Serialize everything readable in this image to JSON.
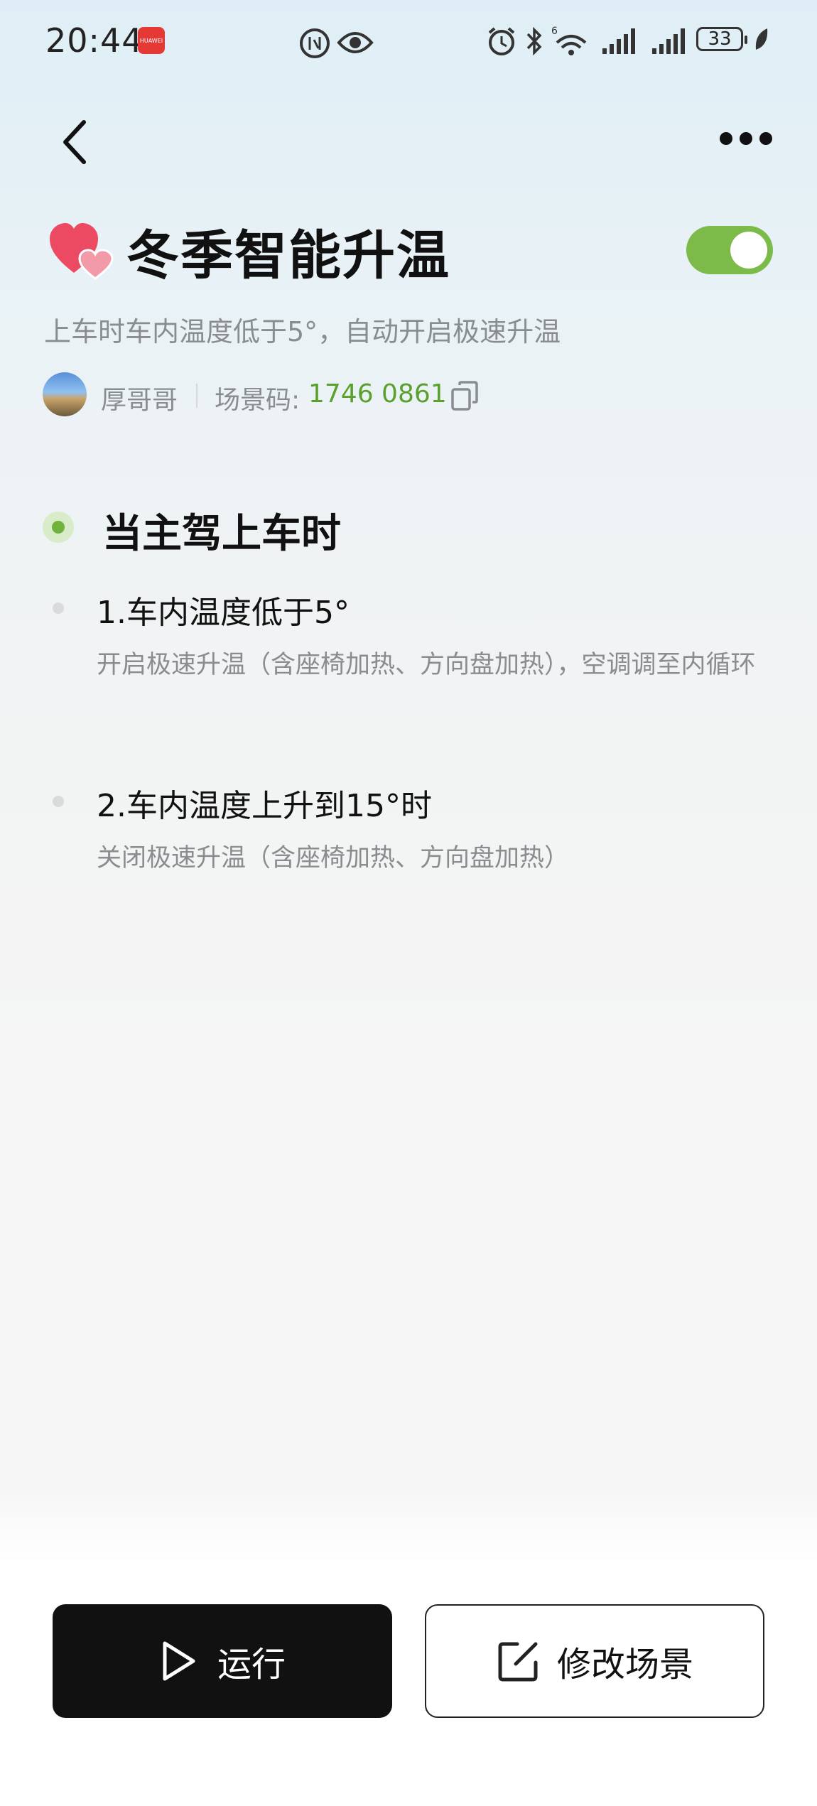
{
  "status_bar": {
    "time": "20:44",
    "app_badge": "HUAWEI",
    "battery": "33"
  },
  "scene": {
    "title": "冬季智能升温",
    "subtitle": "上车时车内温度低于5°，自动开启极速升温",
    "enabled": true,
    "author": "厚哥哥",
    "code_label": "场景码:",
    "code_value": "1746 0861"
  },
  "trigger": {
    "label": "当主驾上车时"
  },
  "steps": [
    {
      "title": "1.车内温度低于5°",
      "desc": "开启极速升温（含座椅加热、方向盘加热），空调调至内循环"
    },
    {
      "title": "2.车内温度上升到15°时",
      "desc": "关闭极速升温（含座椅加热、方向盘加热）"
    }
  ],
  "actions": {
    "run_label": "运行",
    "edit_label": "修改场景"
  },
  "colors": {
    "accent_green": "#7cbb4a",
    "code_green": "#5aa02c"
  }
}
